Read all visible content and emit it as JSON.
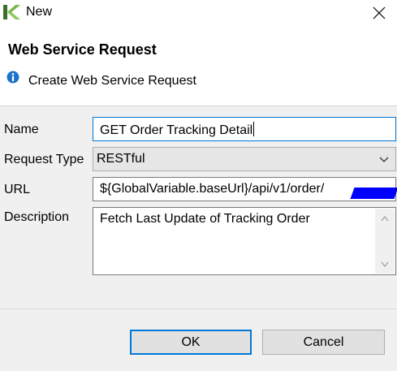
{
  "window": {
    "title": "New",
    "icons": {
      "app": "knime-app-icon",
      "close": "close-icon"
    }
  },
  "header": {
    "title": "Web Service Request",
    "description": "Create Web Service Request",
    "icon": "info-icon"
  },
  "form": {
    "name_label": "Name",
    "name_value": "GET Order Tracking Detail",
    "request_type_label": "Request Type",
    "request_type_value": "RESTful",
    "url_label": "URL",
    "url_value": "${GlobalVariable.baseUrl}/api/v1/order/",
    "description_label": "Description",
    "description_value": "Fetch Last Update of Tracking Order"
  },
  "buttons": {
    "ok_label": "OK",
    "cancel_label": "Cancel"
  },
  "colors": {
    "focus_border": "#0078d7",
    "redaction": "#0000ff",
    "logo_green": "#7ab648"
  }
}
